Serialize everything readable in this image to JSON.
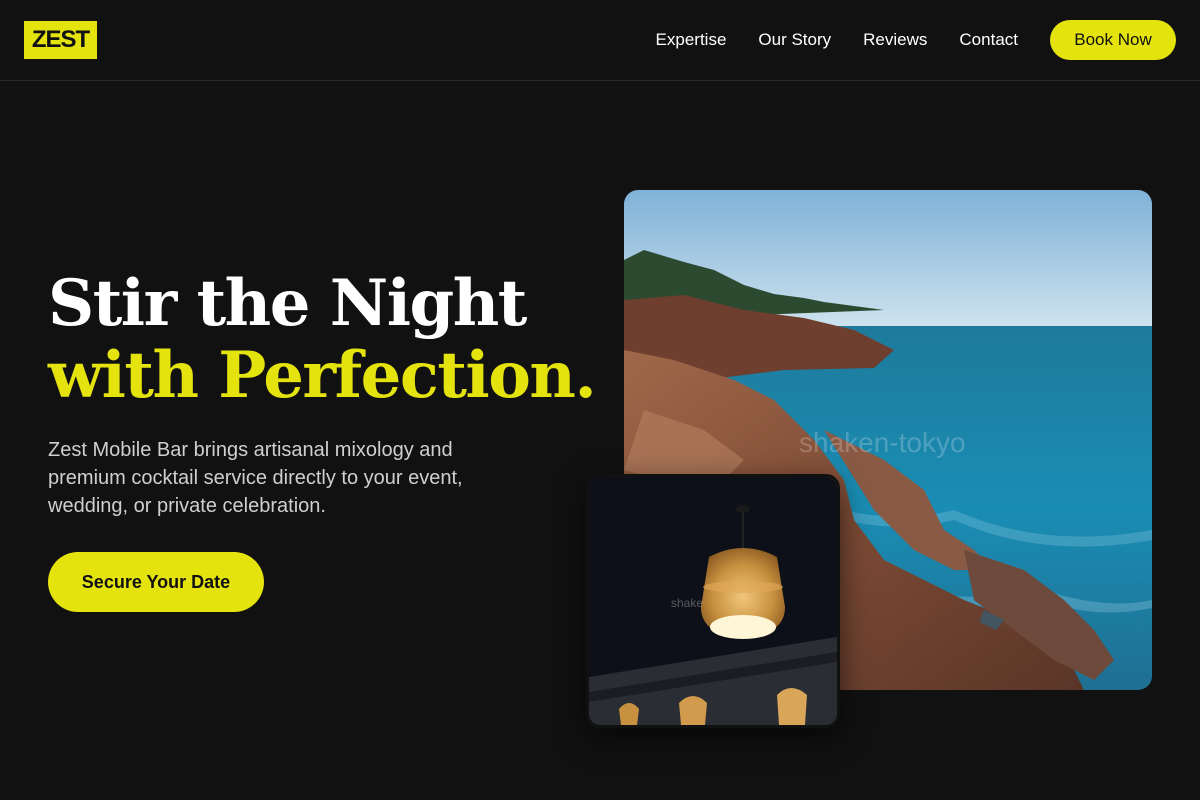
{
  "brand": {
    "logo_text": "ZEST",
    "accent_color": "#e4e30e",
    "background_color": "#111111"
  },
  "nav": {
    "links": [
      "Expertise",
      "Our Story",
      "Reviews",
      "Contact"
    ],
    "book_label": "Book Now"
  },
  "hero": {
    "title_line1": "Stir the Night",
    "title_line2": "with Perfection.",
    "description": "Zest Mobile Bar brings artisanal mixology and premium cocktail service directly to your event, wedding, or private celebration.",
    "cta_label": "Secure Your Date"
  },
  "images": {
    "main": {
      "subject": "rocky coastline by the sea",
      "watermark": "shaken-tokyo"
    },
    "secondary": {
      "subject": "woven rattan pendant lamp",
      "watermark": "shake"
    }
  }
}
